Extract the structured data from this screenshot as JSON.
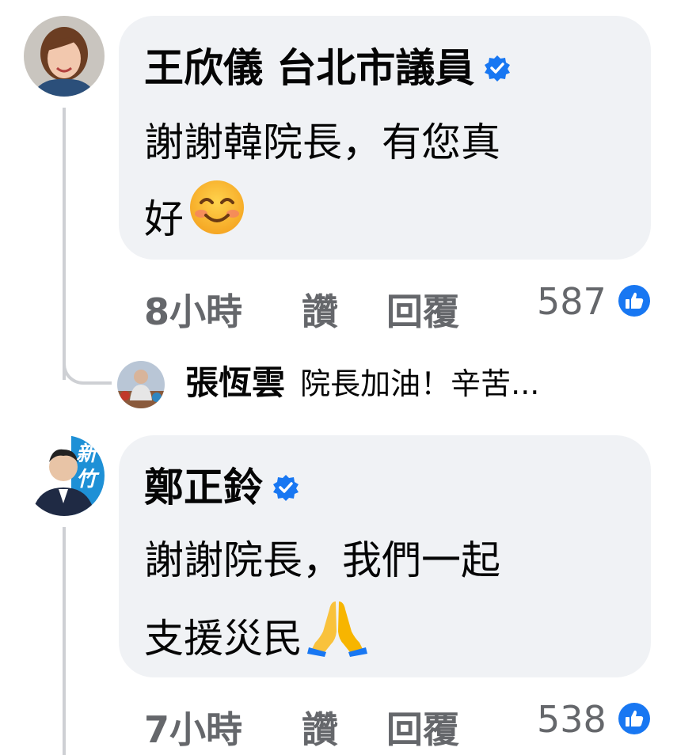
{
  "comments": [
    {
      "author": "王欣儀 台北市議員",
      "verified": true,
      "text_line1": "謝謝韓院長，有您真",
      "text_line2": "好",
      "emoji": "smiling-face-with-smiling-eyes",
      "time": "8小時",
      "like_label": "讚",
      "reply_label": "回覆",
      "reaction_count": "587",
      "reply": {
        "author": "張恆雲",
        "text": "院長加油！辛苦..."
      }
    },
    {
      "author": "鄭正鈴",
      "verified": true,
      "avatar_badge_text": "新竹",
      "text_line1": "謝謝院長，我們一起",
      "text_line2": "支援災民",
      "emoji": "folded-hands",
      "time": "7小時",
      "like_label": "讚",
      "reply_label": "回覆",
      "reaction_count": "538"
    }
  ],
  "colors": {
    "bubble": "#f0f2f5",
    "meta": "#65676b",
    "like_blue": "#1877f2",
    "thread_line": "#ced0d4"
  }
}
